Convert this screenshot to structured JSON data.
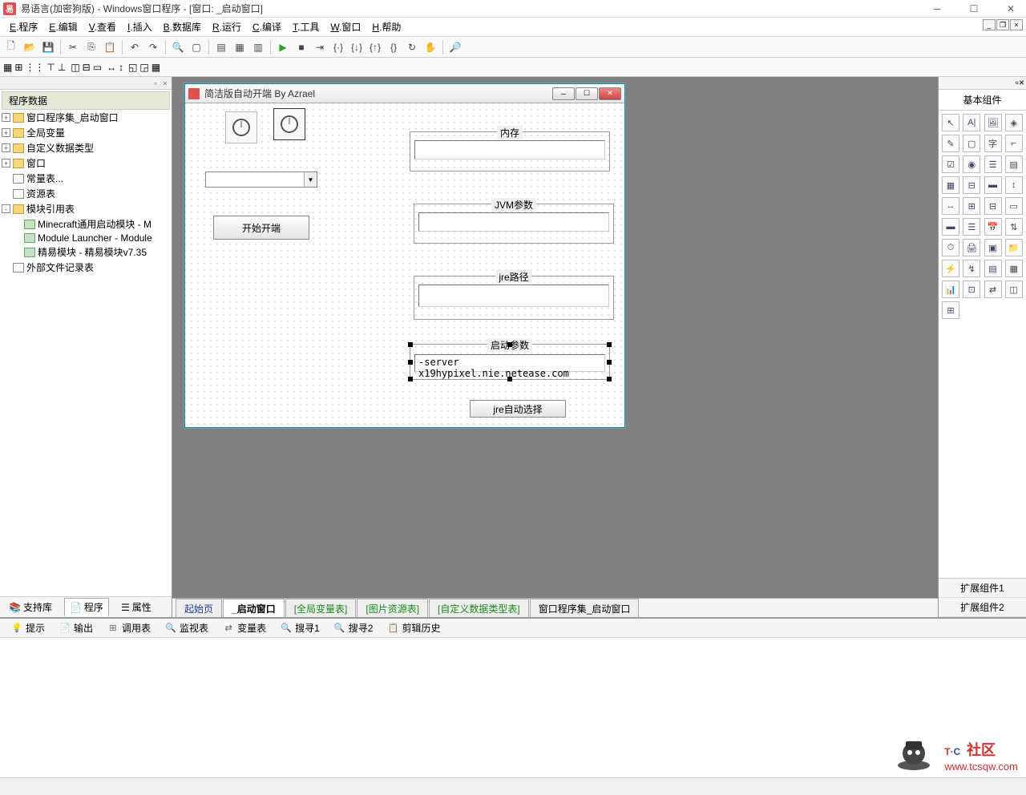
{
  "titlebar": {
    "title": "易语言(加密狗版) - Windows窗口程序 - [窗口: _启动窗口]"
  },
  "menubar": {
    "items": [
      {
        "u": "E",
        "label": ".程序"
      },
      {
        "u": "E",
        "label": ".编辑"
      },
      {
        "u": "V",
        "label": ".查看"
      },
      {
        "u": "I",
        "label": ".插入"
      },
      {
        "u": "B",
        "label": ".数据库"
      },
      {
        "u": "R",
        "label": ".运行"
      },
      {
        "u": "C",
        "label": ".编译"
      },
      {
        "u": "T",
        "label": ".工具"
      },
      {
        "u": "W",
        "label": ".窗口"
      },
      {
        "u": "H",
        "label": ".帮助"
      }
    ]
  },
  "tree": {
    "title": "程序数据",
    "nodes": [
      {
        "level": 0,
        "exp": "+",
        "icon": "folder",
        "label": "窗口程序集_启动窗口"
      },
      {
        "level": 0,
        "exp": "+",
        "icon": "folder",
        "label": "全局变量"
      },
      {
        "level": 0,
        "exp": "+",
        "icon": "folder",
        "label": "自定义数据类型"
      },
      {
        "level": 0,
        "exp": "+",
        "icon": "folder",
        "label": "窗口"
      },
      {
        "level": 0,
        "exp": "",
        "icon": "doc",
        "label": "常量表..."
      },
      {
        "level": 0,
        "exp": "",
        "icon": "doc",
        "label": "资源表"
      },
      {
        "level": 0,
        "exp": "-",
        "icon": "folder",
        "label": "模块引用表"
      },
      {
        "level": 1,
        "exp": "",
        "icon": "mod",
        "label": "Minecraft通用启动模块 - M"
      },
      {
        "level": 1,
        "exp": "",
        "icon": "mod",
        "label": "Module Launcher - Module"
      },
      {
        "level": 1,
        "exp": "",
        "icon": "mod",
        "label": "精易模块 - 精易模块v7.35"
      },
      {
        "level": 0,
        "exp": "",
        "icon": "doc",
        "label": "外部文件记录表"
      }
    ]
  },
  "leftTabs": {
    "support": "支持库",
    "program": "程序",
    "property": "属性"
  },
  "form": {
    "title": "简洁版自动开端 By Azrael",
    "startButton": "开始开端",
    "groupMemory": "内存",
    "groupJvm": "JVM参数",
    "groupJre": "jre路径",
    "groupLaunch": "启动参数",
    "launchValue": "-server x19hypixel.nie.netease.com",
    "jreAutoButton": "jre自动选择"
  },
  "centerTabs": {
    "start": "起始页",
    "startWin": "_启动窗口",
    "globalVar": "[全局变量表]",
    "imgRes": "[图片资源表]",
    "customType": "[自定义数据类型表]",
    "winCollection": "窗口程序集_启动窗口"
  },
  "rightPanel": {
    "title": "基本组件",
    "ext1": "扩展组件1",
    "ext2": "扩展组件2"
  },
  "bottomTabs": {
    "hint": "提示",
    "output": "输出",
    "callTable": "调用表",
    "watch": "监视表",
    "varTable": "变量表",
    "search1": "搜寻1",
    "search2": "搜寻2",
    "clipHistory": "剪辑历史"
  },
  "watermark": {
    "main1": "T",
    "main2": "C",
    "cn": "社区",
    "url": "www.tcsqw.com"
  }
}
